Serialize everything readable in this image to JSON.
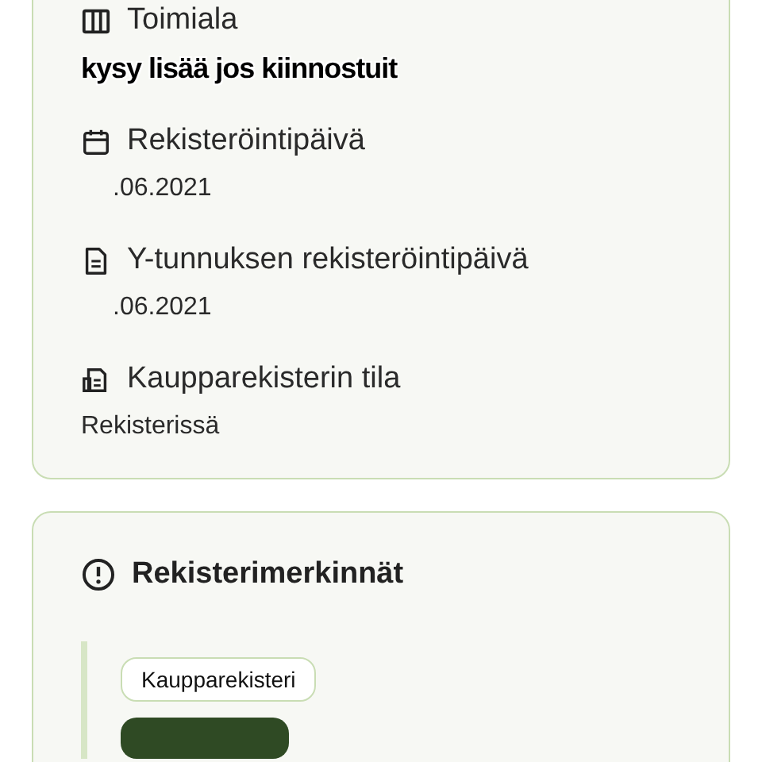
{
  "details_card": {
    "fields": [
      {
        "label": "Toimiala"
      },
      {
        "label": "Rekisteröintipäivä",
        "value": ".06.2021",
        "kind": "date"
      },
      {
        "label": "Y-tunnuksen rekisteröintipäivä",
        "value": ".06.2021",
        "kind": "date"
      },
      {
        "label": "Kaupparekisterin tila",
        "value": "Rekisterissä",
        "kind": "text"
      }
    ]
  },
  "overlay_caption": "kysy lisää jos kiinnostuit",
  "register_entries": {
    "title": "Rekisterimerkinnät",
    "tags": [
      {
        "kind": "outline",
        "label": "Kaupparekisteri"
      },
      {
        "kind": "filled"
      }
    ]
  }
}
